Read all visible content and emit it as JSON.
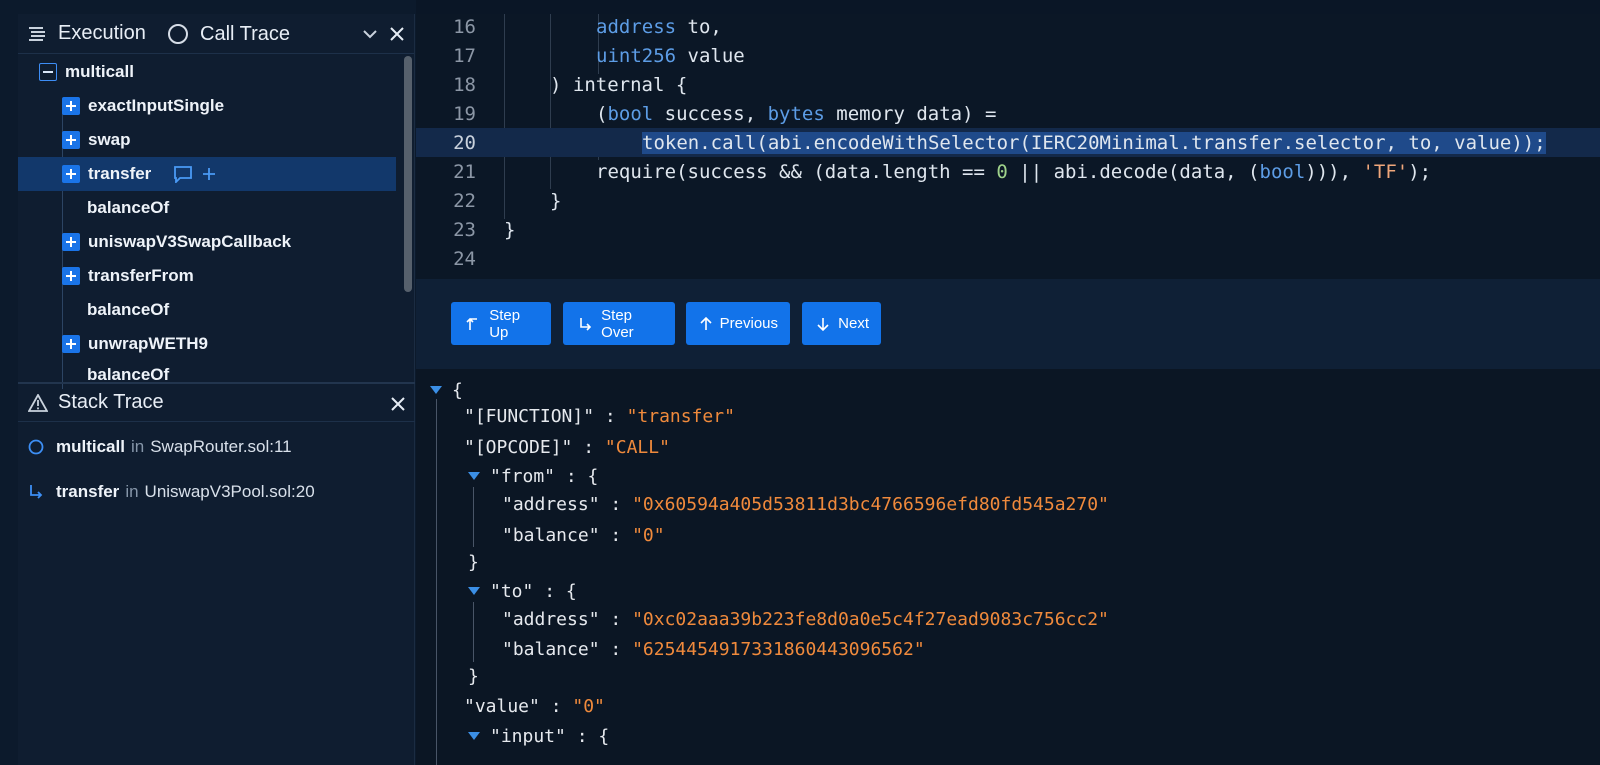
{
  "execution_panel": {
    "title": "Execution",
    "tab_call_trace": "Call Trace",
    "tree": [
      {
        "label": "multicall",
        "toggle": "minus"
      },
      {
        "label": "exactInputSingle",
        "toggle": "plus"
      },
      {
        "label": "swap",
        "toggle": "plus"
      },
      {
        "label": "transfer",
        "toggle": "plus",
        "selected": true
      },
      {
        "label": "balanceOf",
        "toggle": "none"
      },
      {
        "label": "uniswapV3SwapCallback",
        "toggle": "plus"
      },
      {
        "label": "transferFrom",
        "toggle": "plus"
      },
      {
        "label": "balanceOf",
        "toggle": "none"
      },
      {
        "label": "unwrapWETH9",
        "toggle": "plus"
      },
      {
        "label": "balanceOf",
        "toggle": "none"
      }
    ]
  },
  "stack_panel": {
    "title": "Stack Trace",
    "in_word": "in",
    "frames": [
      {
        "fn": "multicall",
        "file": "SwapRouter.sol:11",
        "icon": "circle-icon"
      },
      {
        "fn": "transfer",
        "file": "UniswapV3Pool.sol:20",
        "icon": "step-into-arrow-icon"
      }
    ]
  },
  "editor": {
    "highlighted_line": "20",
    "lines": [
      {
        "no": "16",
        "t1": "address",
        "t2": " to,"
      },
      {
        "no": "17",
        "t1": "uint256",
        "t2": " value"
      },
      {
        "no": "18",
        "text": ") internal {"
      },
      {
        "no": "19",
        "p0": "(",
        "k1": "bool",
        "p1": " success, ",
        "k2": "bytes",
        "p2": " memory data) ="
      },
      {
        "no": "20",
        "text": "token.call(abi.encodeWithSelector(IERC20Minimal.transfer.selector, to, value));"
      },
      {
        "no": "21",
        "p0": "require(success && (data.length == ",
        "n": "0",
        "p1": " || abi.decode(data, (",
        "k": "bool",
        "p2": "))), ",
        "s": "'TF'",
        "p3": ");"
      },
      {
        "no": "22",
        "text": "}"
      },
      {
        "no": "23",
        "text": "}"
      },
      {
        "no": "24",
        "text": ""
      }
    ]
  },
  "buttons": {
    "step_up": "Step Up",
    "step_over": "Step Over",
    "previous": "Previous",
    "next": "Next"
  },
  "json_view": {
    "open_brace": "{",
    "function_key": "\"[FUNCTION]\"",
    "function_val": "\"transfer\"",
    "opcode_key": "\"[OPCODE]\"",
    "opcode_val": "\"CALL\"",
    "from_key": "\"from\"",
    "from_address_key": "\"address\"",
    "from_address_val": "\"0x60594a405d53811d3bc4766596efd80fd545a270\"",
    "from_balance_key": "\"balance\"",
    "from_balance_val": "\"0\"",
    "to_key": "\"to\"",
    "to_address_key": "\"address\"",
    "to_address_val": "\"0xc02aaa39b223fe8d0a0e5c4f27ead9083c756cc2\"",
    "to_balance_key": "\"balance\"",
    "to_balance_val": "\"6254454917331860443096562\"",
    "value_key": "\"value\"",
    "value_val": "\"0\"",
    "input_key": "\"input\"",
    "colon": " : ",
    "obj_open": "{",
    "obj_close": "}"
  },
  "colors": {
    "accent": "#1273ea",
    "selection": "#12386b",
    "json_value": "#f08a3c",
    "keyword": "#5d9de6"
  }
}
